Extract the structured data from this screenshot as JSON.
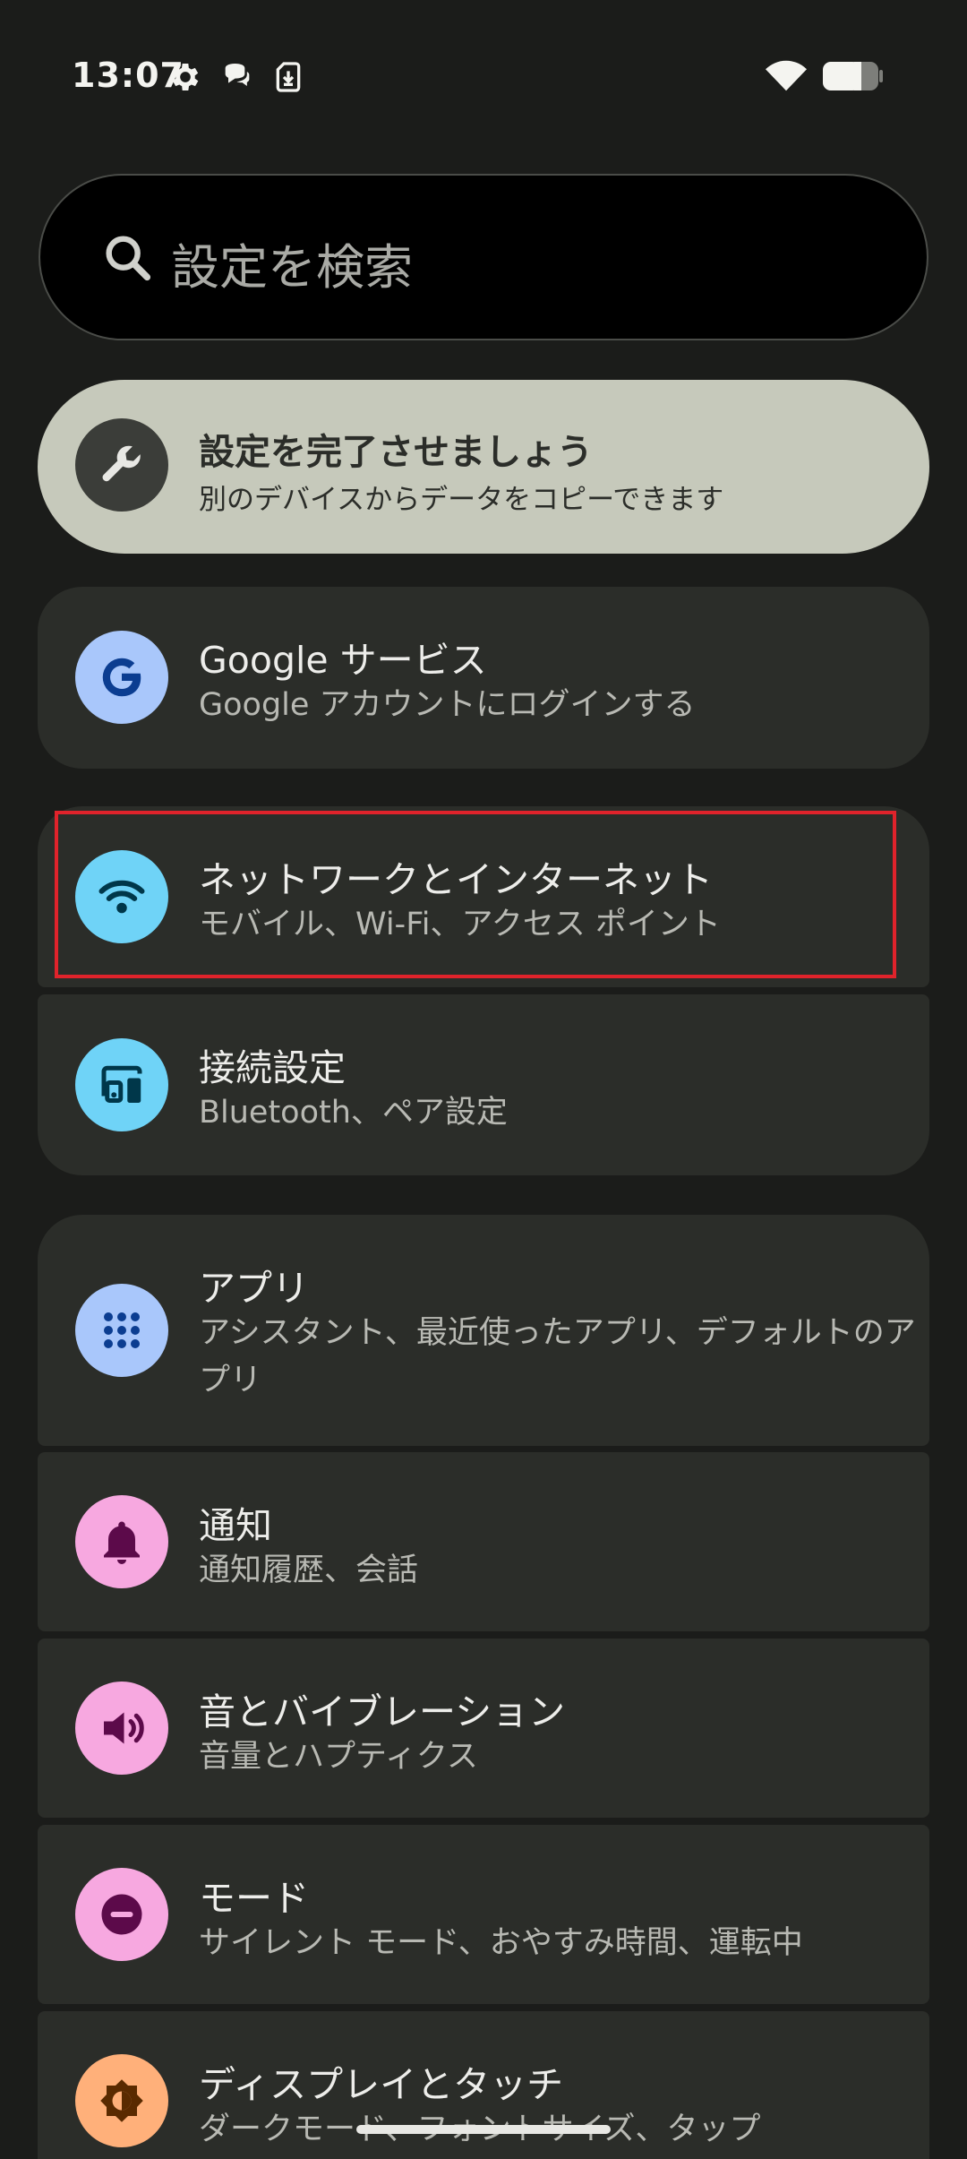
{
  "status_bar": {
    "time": "13:07",
    "icons": [
      "gear-icon",
      "chat-bubble-icon",
      "download-icon",
      "wifi-icon",
      "battery-icon"
    ]
  },
  "search": {
    "placeholder": "設定を検索"
  },
  "suggestion": {
    "title": "設定を完了させましょう",
    "subtitle": "別のデバイスからデータをコピーできます",
    "icon": "wrench-icon",
    "background": "#c6c9bb"
  },
  "items": [
    {
      "id": "google",
      "title": "Google サービス",
      "subtitle": "Google アカウントにログインする",
      "icon": "google-icon",
      "icon_bg": "#a9c7fb",
      "icon_fg": "#0b3d91"
    },
    {
      "id": "network",
      "title": "ネットワークとインターネット",
      "subtitle": "モバイル、Wi-Fi、アクセス ポイント",
      "icon": "wifi-icon",
      "icon_bg": "#6fd3f7",
      "icon_fg": "#00374a"
    },
    {
      "id": "connected",
      "title": "接続設定",
      "subtitle": "Bluetooth、ペア設定",
      "icon": "connected-devices-icon",
      "icon_bg": "#6fd3f7",
      "icon_fg": "#00374a"
    },
    {
      "id": "apps",
      "title": "アプリ",
      "subtitle": "アシスタント、最近使ったアプリ、デフォルトのアプリ",
      "icon": "apps-grid-icon",
      "icon_bg": "#a9c7fb",
      "icon_fg": "#0b3d91"
    },
    {
      "id": "notifications",
      "title": "通知",
      "subtitle": "通知履歴、会話",
      "icon": "bell-icon",
      "icon_bg": "#f7a8e0",
      "icon_fg": "#5c0a4a"
    },
    {
      "id": "sound",
      "title": "音とバイブレーション",
      "subtitle": "音量とハプティクス",
      "icon": "speaker-icon",
      "icon_bg": "#f7a8e0",
      "icon_fg": "#5c0a4a"
    },
    {
      "id": "modes",
      "title": "モード",
      "subtitle": "サイレント モード、おやすみ時間、運転中",
      "icon": "do-not-disturb-icon",
      "icon_bg": "#f7a8e0",
      "icon_fg": "#5c0a4a"
    },
    {
      "id": "display",
      "title": "ディスプレイとタッチ",
      "subtitle": "ダークモード、フォントサイズ、タップ",
      "icon": "brightness-icon",
      "icon_bg": "#ffb07a",
      "icon_fg": "#5a2a00"
    }
  ],
  "colors": {
    "background": "#1b1c1a",
    "card": "#2b2d29",
    "highlight": "#e0232b"
  }
}
